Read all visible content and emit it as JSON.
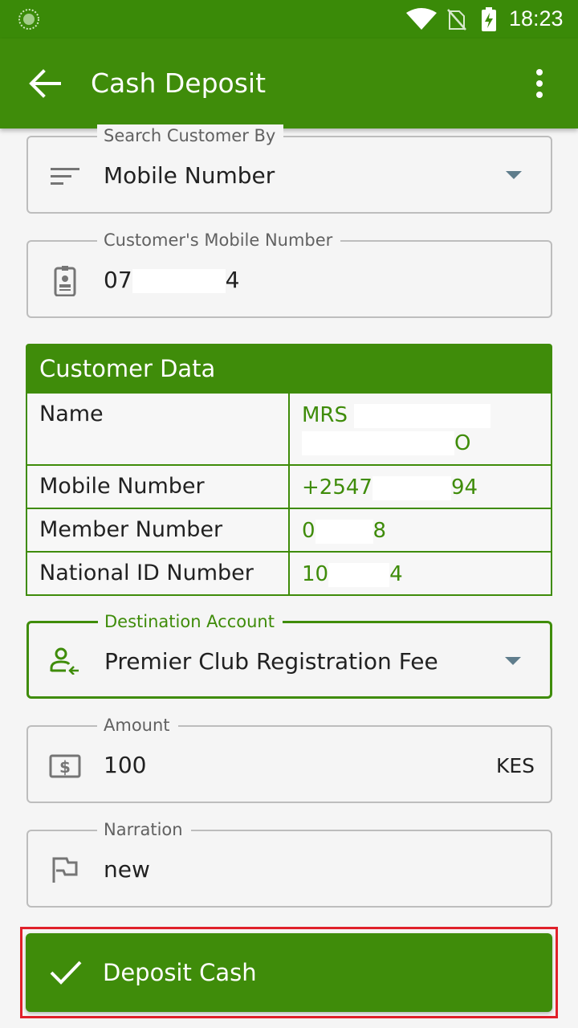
{
  "status_bar": {
    "time": "18:23"
  },
  "app_bar": {
    "title": "Cash Deposit"
  },
  "search_by": {
    "label": "Search Customer By",
    "value": "Mobile Number"
  },
  "mobile": {
    "label": "Customer's Mobile Number",
    "value_prefix": "07",
    "value_suffix": "4"
  },
  "customer_data": {
    "title": "Customer Data",
    "rows": [
      {
        "key": "Name",
        "value_prefix": "MRS",
        "value_suffix": "O"
      },
      {
        "key": "Mobile Number",
        "value_prefix": "+2547",
        "value_suffix": "94"
      },
      {
        "key": "Member Number",
        "value_prefix": "0",
        "value_suffix": "8"
      },
      {
        "key": "National ID Number",
        "value_prefix": "10",
        "value_suffix": "4"
      }
    ]
  },
  "destination": {
    "label": "Destination Account",
    "value": "Premier Club Registration Fee"
  },
  "amount": {
    "label": "Amount",
    "value": "100",
    "currency": "KES"
  },
  "narration": {
    "label": "Narration",
    "value": "new"
  },
  "deposit_button": {
    "label": "Deposit Cash"
  },
  "colors": {
    "primary": "#3f8c0a",
    "status_bar": "#3a8a08",
    "highlight": "#e0202a"
  }
}
